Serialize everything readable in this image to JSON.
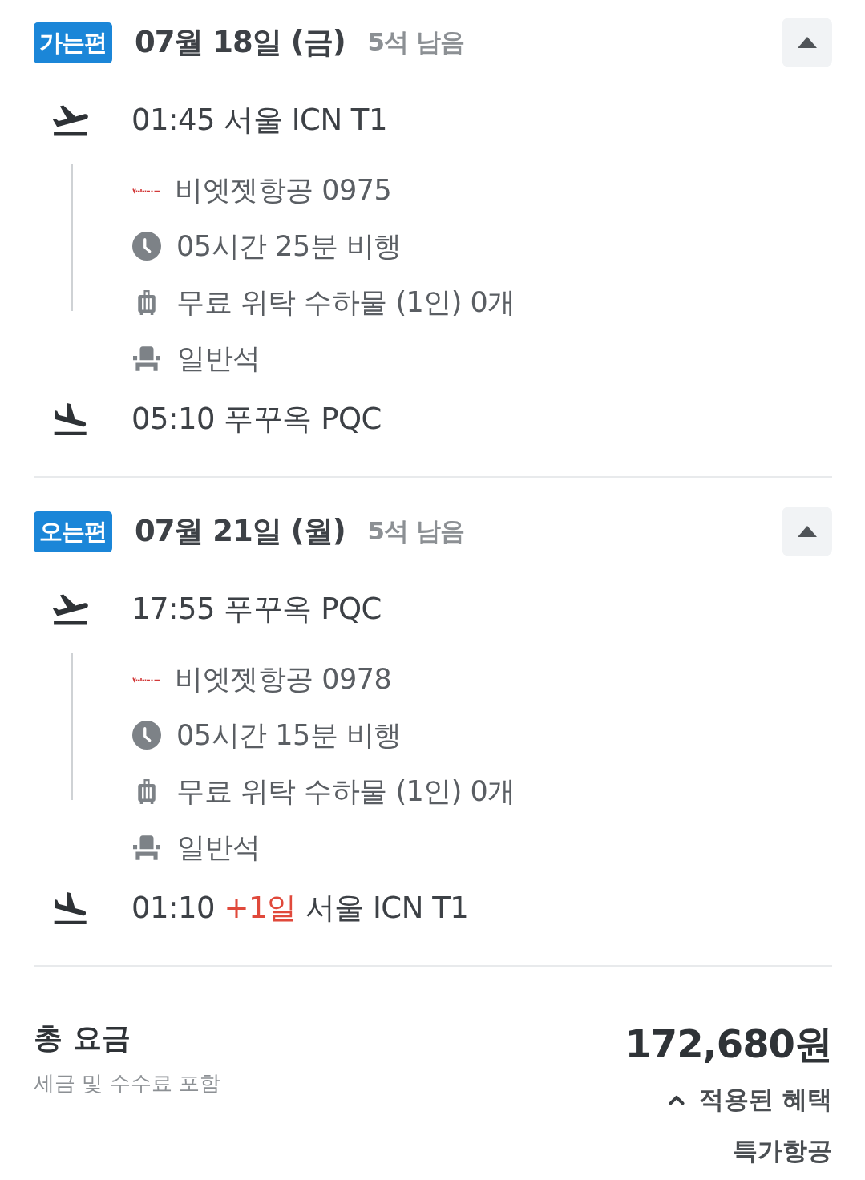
{
  "legs": [
    {
      "badge": "가는편",
      "date": "07월 18일 (금)",
      "seats_left": "5석 남음",
      "expanded": true,
      "departure": {
        "time": "01:45",
        "place": "서울 ICN T1"
      },
      "details": [
        {
          "kind": "airline",
          "text": "비엣젯항공 0975"
        },
        {
          "kind": "duration",
          "text": "05시간 25분 비행"
        },
        {
          "kind": "baggage",
          "text": "무료 위탁 수하물 (1인) 0개"
        },
        {
          "kind": "cabin",
          "text": "일반석"
        }
      ],
      "arrival": {
        "time": "05:10",
        "place": "푸꾸옥 PQC"
      }
    },
    {
      "badge": "오는편",
      "date": "07월 21일 (월)",
      "seats_left": "5석 남음",
      "expanded": true,
      "departure": {
        "time": "17:55",
        "place": "푸꾸옥 PQC"
      },
      "details": [
        {
          "kind": "airline",
          "text": "비엣젯항공 0978"
        },
        {
          "kind": "duration",
          "text": "05시간 15분 비행"
        },
        {
          "kind": "baggage",
          "text": "무료 위탁 수하물 (1인) 0개"
        },
        {
          "kind": "cabin",
          "text": "일반석"
        }
      ],
      "arrival": {
        "time": "01:10",
        "day_offset": "+1일",
        "place": "서울 ICN T1"
      }
    }
  ],
  "total": {
    "label": "총 요금",
    "note": "세금 및 수수료 포함",
    "price": "172,680원",
    "benefits": {
      "label": "적용된 혜택",
      "expanded": true,
      "items": [
        "특가항공"
      ]
    }
  }
}
